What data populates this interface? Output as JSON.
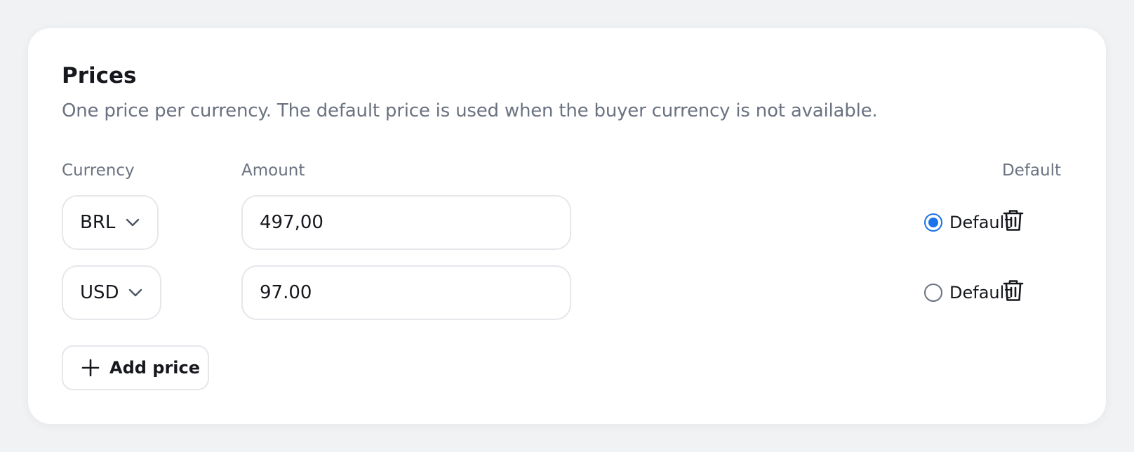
{
  "section": {
    "title": "Prices",
    "description": "One price per currency. The default price is used when the buyer currency is not available."
  },
  "columns": {
    "currency": "Currency",
    "amount": "Amount",
    "default": "Default"
  },
  "rows": [
    {
      "currency": "BRL",
      "amount": "497,00",
      "default_label": "Default",
      "is_default": true
    },
    {
      "currency": "USD",
      "amount": "97.00",
      "default_label": "Default",
      "is_default": false
    }
  ],
  "add_button": {
    "label": "Add price"
  },
  "icons": {
    "currency_dropdown": "chevron-down-icon",
    "delete": "trash-icon",
    "add": "plus-icon"
  },
  "colors": {
    "accent": "#1a73e8",
    "muted_text": "#6b7280",
    "border": "#e5e7eb"
  }
}
